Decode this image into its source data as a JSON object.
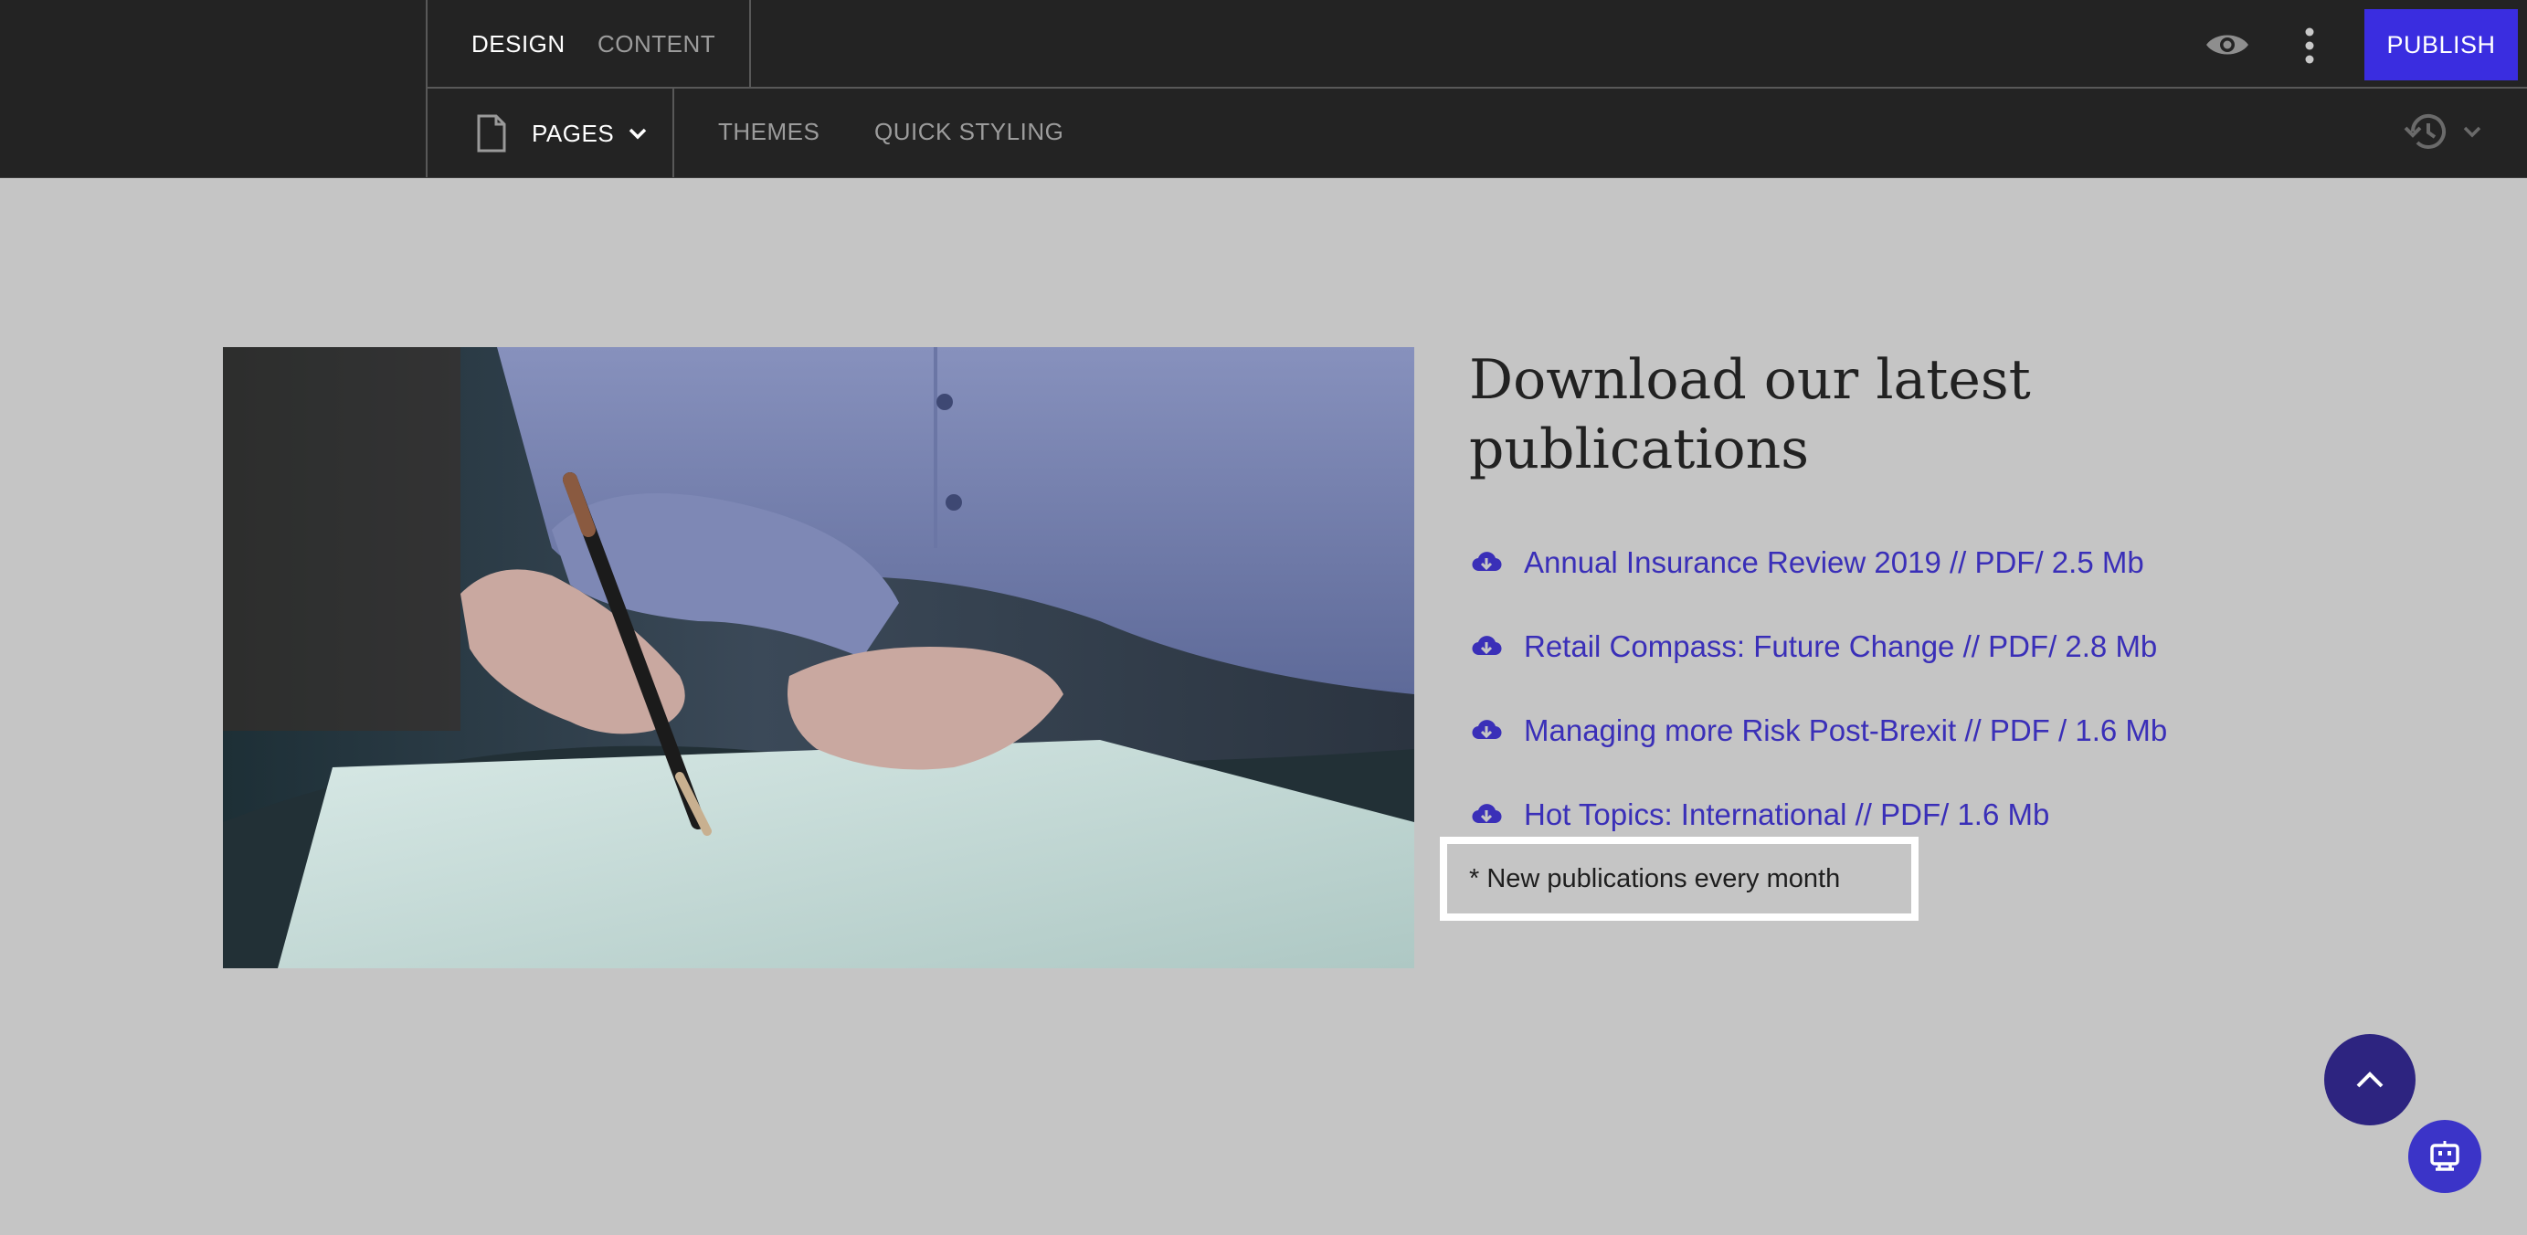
{
  "topbar": {
    "tabs": [
      {
        "label": "DESIGN",
        "active": true
      },
      {
        "label": "CONTENT",
        "active": false
      }
    ],
    "publish_label": "PUBLISH",
    "pages_label": "PAGES",
    "secondary_tabs": [
      "THEMES",
      "QUICK STYLING"
    ]
  },
  "icons": {
    "preview": "eye-icon",
    "more": "more-vertical-icon",
    "page": "document-icon",
    "dropdown": "chevron-down-icon",
    "history": "history-icon",
    "download": "cloud-download-icon",
    "scroll_top": "chevron-up-icon",
    "chat": "chat-bot-icon"
  },
  "content": {
    "heading": "Download our latest publications",
    "publications": [
      "Annual Insurance Review 2019 // PDF/ 2.5 Mb",
      "Retail Compass: Future Change // PDF/ 2.8 Mb",
      "Managing more Risk Post-Brexit // PDF / 1.6 Mb",
      "Hot Topics: International // PDF/ 1.6 Mb"
    ],
    "note": "* New publications every month"
  },
  "colors": {
    "toolbar_bg": "#232323",
    "canvas_bg": "#c5c5c5",
    "accent": "#3a2de0",
    "link": "#3a2fb8",
    "scroll_top_bg": "#2d2480"
  }
}
